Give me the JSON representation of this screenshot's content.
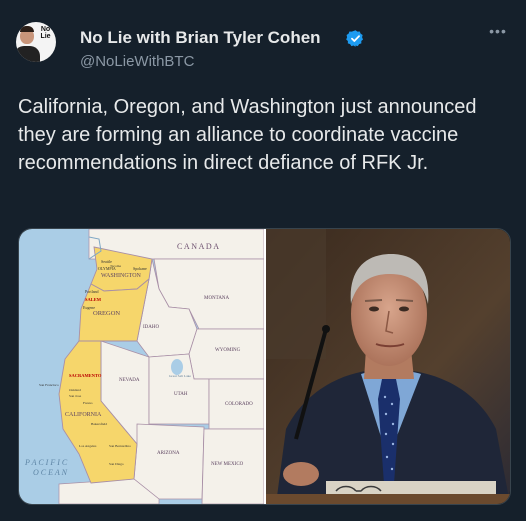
{
  "author": {
    "display_name": "No Lie with Brian Tyler Cohen",
    "handle": "@NoLieWithBTC",
    "avatar_logo_line1": "No",
    "avatar_logo_line2": "Lie"
  },
  "tweet": {
    "text": "California, Oregon, and Washington just announced they are forming an alliance to coordinate vaccine recommendations in direct defiance of RFK Jr."
  },
  "map": {
    "labels": {
      "canada": "C A N A D A",
      "washington": "WASHINGTON",
      "seattle": "Seattle",
      "olympia": "OLYMPIA",
      "spokane": "Spokane",
      "tacoma": "Tacoma",
      "salem": "SALEM",
      "eugene": "Eugene",
      "portland": "Portland",
      "oregon": "OREGON",
      "idaho": "IDAHO",
      "montana": "MONTANA",
      "wyoming": "WYOMING",
      "nevada": "NEVADA",
      "utah": "UTAH",
      "colorado": "COLORADO",
      "arizona": "ARIZONA",
      "new_mexico": "NEW MEXICO",
      "california": "CALIFORNIA",
      "sacramento": "SACRAMENTO",
      "san_francisco": "San Francisco",
      "oakland": "Oakland",
      "san_jose": "San Jose",
      "fresno": "Fresno",
      "bakersfield": "Bakersfield",
      "los_angeles": "Los Angeles",
      "san_bernardino": "San Bernardino",
      "san_diego": "San Diego",
      "great_salt_lake": "Great Salt Lake",
      "pacific_ocean_1": "P A C I F I C",
      "pacific_ocean_2": "O C E A N"
    }
  },
  "colors": {
    "background": "#15202b",
    "text_primary": "#e7e9ea",
    "text_secondary": "#8b98a5",
    "verified": "#1d9bf0",
    "ocean": "#aacde6",
    "highlight_states": "#f6d66b",
    "other_states": "#f4f1ea"
  },
  "icons": [
    "verified-badge-icon",
    "more-icon"
  ]
}
